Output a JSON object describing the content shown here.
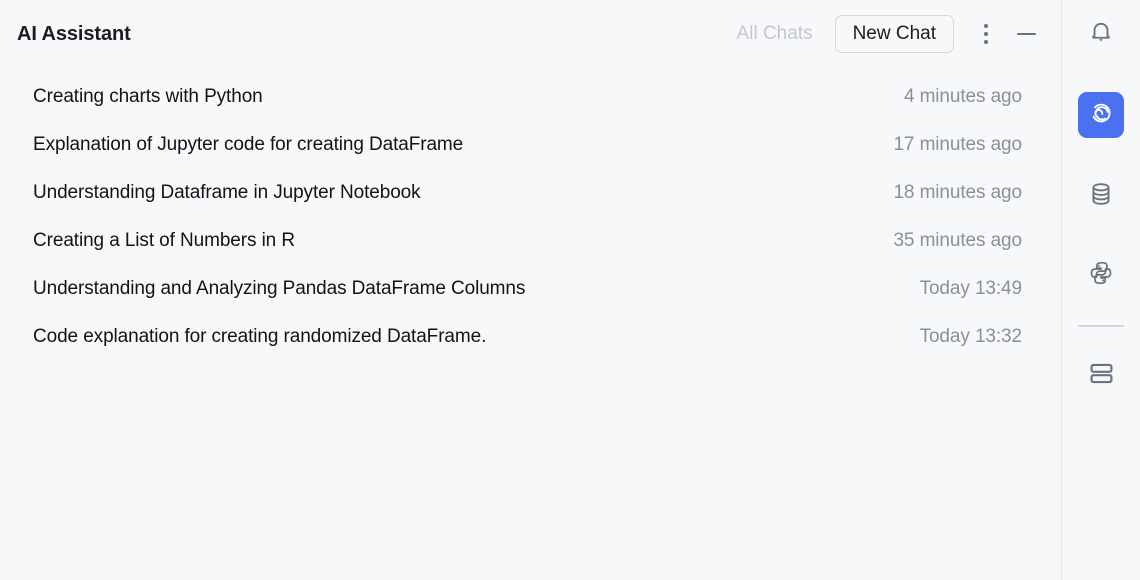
{
  "window": {
    "title": "AI Assistant",
    "background_color": "#f7f8fa",
    "accent_color": "#4a72f0"
  },
  "titlebar": {
    "title": "AI Assistant",
    "all_chats_label": "All Chats",
    "new_chat_label": "New Chat",
    "more_options_icon": "kebab-menu-icon",
    "minimize_icon": "minimize-icon"
  },
  "chat_list": {
    "items": [
      {
        "title": "Creating charts with Python",
        "time": "4 minutes ago"
      },
      {
        "title": "Explanation of Jupyter code for creating DataFrame",
        "time": "17 minutes ago"
      },
      {
        "title": "Understanding Dataframe in Jupyter Notebook",
        "time": "18 minutes ago"
      },
      {
        "title": "Creating a List of Numbers in R",
        "time": "35 minutes ago"
      },
      {
        "title": "Understanding and Analyzing Pandas DataFrame Columns",
        "time": "Today 13:49"
      },
      {
        "title": "Code explanation for creating randomized DataFrame.",
        "time": "Today 13:32"
      }
    ]
  },
  "tool_sidebar": {
    "items": [
      {
        "name": "notifications",
        "icon": "bell-icon",
        "selected": false
      },
      {
        "name": "ai-assistant",
        "icon": "spiral-icon",
        "selected": true
      },
      {
        "name": "database",
        "icon": "database-icon",
        "selected": false
      },
      {
        "name": "python-packages",
        "icon": "python-icon",
        "selected": false
      },
      {
        "name": "layout-panels",
        "icon": "stacked-panels-icon",
        "selected": false
      }
    ]
  }
}
